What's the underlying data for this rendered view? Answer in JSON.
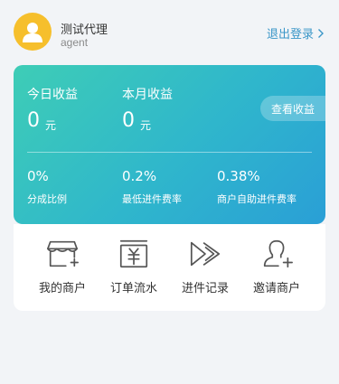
{
  "user": {
    "name": "测试代理",
    "role": "agent"
  },
  "header": {
    "logout_label": "退出登录"
  },
  "card": {
    "today_income_label": "今日收益",
    "today_income_value": "0",
    "today_income_unit": "元",
    "month_income_label": "本月收益",
    "month_income_value": "0",
    "month_income_unit": "元",
    "view_income_button": "查看收益",
    "stats": [
      {
        "value": "0%",
        "label": "分成比例"
      },
      {
        "value": "0.2%",
        "label": "最低进件费率"
      },
      {
        "value": "0.38%",
        "label": "商户自助进件费率"
      }
    ]
  },
  "menu": [
    {
      "label": "我的商户",
      "icon": "store-icon"
    },
    {
      "label": "订单流水",
      "icon": "order-flow-icon"
    },
    {
      "label": "进件记录",
      "icon": "fast-forward-icon"
    },
    {
      "label": "邀请商户",
      "icon": "invite-user-icon"
    }
  ],
  "colors": {
    "accent_link": "#3a96c8",
    "card_gradient_start": "#3ecdb6",
    "card_gradient_end": "#2a9fd6",
    "avatar_bg": "#f6bf2c"
  }
}
